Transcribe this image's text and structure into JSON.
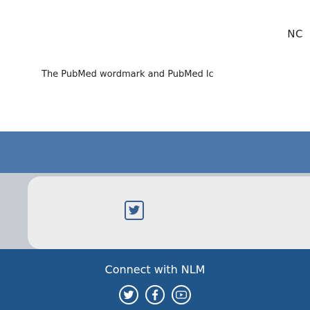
{
  "header": {
    "nc_label": "NC",
    "wordmark_text": "The PubMed wordmark and PubMed lc"
  },
  "social_card": {
    "icon": "twitter-icon"
  },
  "footer": {
    "title": "Connect with NLM",
    "icons": [
      "twitter-icon",
      "facebook-icon",
      "youtube-icon"
    ]
  },
  "colors": {
    "band": "#4a78aa",
    "footer": "#20558a",
    "card": "#ececec"
  }
}
